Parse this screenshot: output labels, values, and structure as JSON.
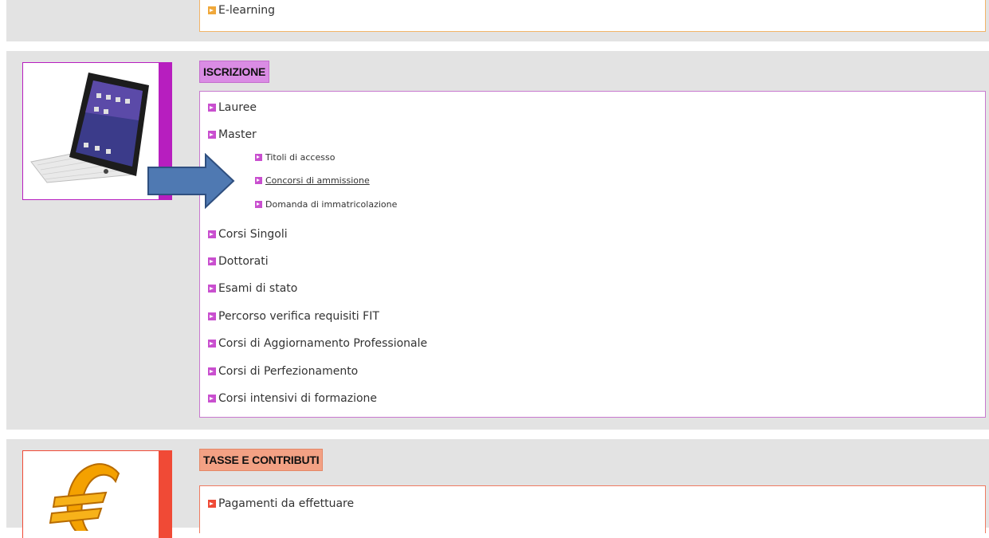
{
  "top_section": {
    "last_item": "E-learning"
  },
  "iscrizione": {
    "title": "ISCRIZIONE",
    "accent": "#b71ebf",
    "title_bg": "#da8ce4",
    "items": [
      "Lauree",
      "Master",
      "Corsi Singoli",
      "Dottorati",
      "Esami di stato",
      "Percorso verifica requisiti FIT",
      "Corsi di Aggiornamento Professionale",
      "Corsi di Perfezionamento",
      "Corsi intensivi di formazione"
    ],
    "master_subitems": [
      "Titoli di accesso",
      "Concorsi di ammissione",
      "Domanda di immatricolazione"
    ]
  },
  "tasse": {
    "title": "TASSE E CONTRIBUTI",
    "accent": "#f04a36",
    "title_bg": "#f3a184",
    "items": [
      "Pagamenti da effettuare"
    ]
  },
  "icons": {
    "iscrizione_thumb": "tablet-keyboard-icon",
    "tasse_thumb": "euro-icon",
    "pointer": "arrow-right-icon"
  }
}
